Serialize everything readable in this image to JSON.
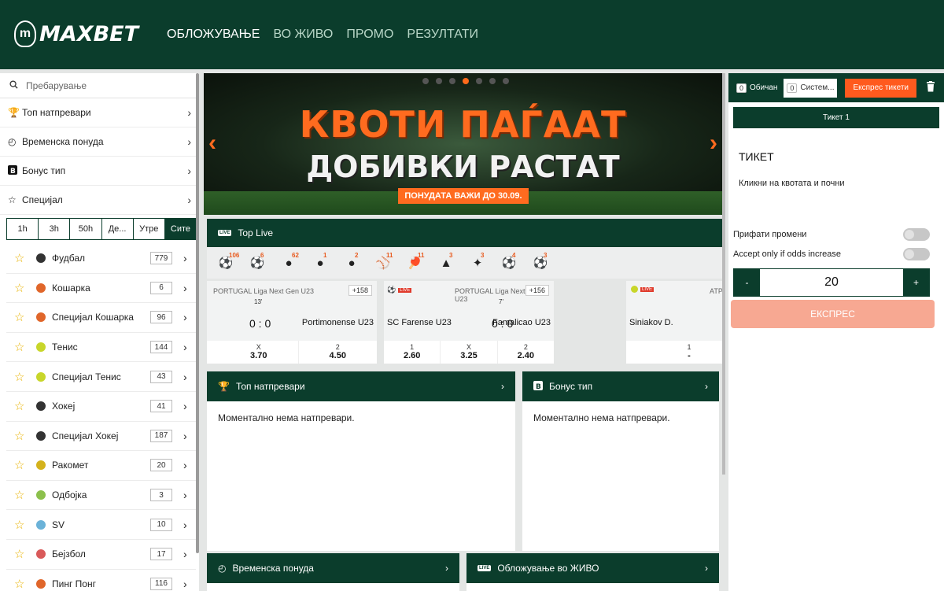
{
  "header": {
    "logo_badge": "m",
    "logo_text": "MAXBET",
    "nav": [
      {
        "label": "ОБЛОЖУВАЊЕ"
      },
      {
        "label": "ВО ЖИВО"
      },
      {
        "label": "ПРОМО"
      },
      {
        "label": "РЕЗУЛТАТИ"
      }
    ]
  },
  "sidebar": {
    "search_placeholder": "Пребарување",
    "menu": [
      {
        "label": "Топ натпревари",
        "icon": "trophy-icon"
      },
      {
        "label": "Временска понуда",
        "icon": "clock-icon"
      },
      {
        "label": "Бонус тип",
        "icon": "bonus-icon"
      },
      {
        "label": "Специјал",
        "icon": "star-icon"
      }
    ],
    "time_filters": [
      "1h",
      "3h",
      "50h",
      "Де...",
      "Утре",
      "Сите"
    ],
    "sports": [
      {
        "name": "Фудбал",
        "count": "779",
        "color": "#333333"
      },
      {
        "name": "Кошарка",
        "count": "6",
        "color": "#e0662a"
      },
      {
        "name": "Специјал Кошарка",
        "count": "96",
        "color": "#e0662a"
      },
      {
        "name": "Тенис",
        "count": "144",
        "color": "#c8d62a"
      },
      {
        "name": "Специјал Тенис",
        "count": "43",
        "color": "#c8d62a"
      },
      {
        "name": "Хокеј",
        "count": "41",
        "color": "#333333"
      },
      {
        "name": "Специјал Хокеј",
        "count": "187",
        "color": "#333333"
      },
      {
        "name": "Ракомет",
        "count": "20",
        "color": "#d4b21c"
      },
      {
        "name": "Одбојка",
        "count": "3",
        "color": "#8cc04c"
      },
      {
        "name": "SV",
        "count": "10",
        "color": "#6bb2d8"
      },
      {
        "name": "Бејзбол",
        "count": "17",
        "color": "#d95a5a"
      },
      {
        "name": "Пинг Понг",
        "count": "116",
        "color": "#e0662a"
      }
    ]
  },
  "banner": {
    "line1": "КВОТИ ПАЃААТ",
    "line2": "ДОБИВКИ РАСТАТ",
    "caption": "ПОНУДАТА ВАЖИ ДО 30.09."
  },
  "top_live": {
    "title": "Top Live",
    "live_label": "LIVE",
    "sport_icons": [
      {
        "glyph": "⚽",
        "count": "106"
      },
      {
        "glyph": "⚽",
        "count": "6"
      },
      {
        "glyph": "●",
        "count": "62"
      },
      {
        "glyph": "●",
        "count": "1"
      },
      {
        "glyph": "●",
        "count": "2"
      },
      {
        "glyph": "⚾",
        "count": "11"
      },
      {
        "glyph": "🏓",
        "count": "11"
      },
      {
        "glyph": "▲",
        "count": "3"
      },
      {
        "glyph": "✦",
        "count": "3"
      },
      {
        "glyph": "⚽",
        "count": "4"
      },
      {
        "glyph": "⚽",
        "count": "3"
      }
    ],
    "matches": [
      {
        "league": "PORTUGAL Liga Next Gen U23",
        "minute": "13'",
        "plus": "+158",
        "score": "0 : 0",
        "home": "",
        "away": "Portimonense U23",
        "odds": [
          {
            "label": "X",
            "value": "3.70"
          },
          {
            "label": "2",
            "value": "4.50"
          }
        ]
      },
      {
        "league": "PORTUGAL Liga Next Gen U23",
        "minute": "7'",
        "plus": "+156",
        "score": "0 : 0",
        "home": "SC Farense U23",
        "away": "Famalicao U23",
        "odds": [
          {
            "label": "1",
            "value": "2.60"
          },
          {
            "label": "X",
            "value": "3.25"
          },
          {
            "label": "2",
            "value": "2.40"
          }
        ]
      },
      {
        "league": "ATP",
        "minute": "",
        "plus": "",
        "score": "",
        "home": "Siniakov D.",
        "away": "",
        "odds": [
          {
            "label": "1",
            "value": "-"
          }
        ]
      }
    ]
  },
  "panels": {
    "top_matches": {
      "title": "Топ натпревари",
      "empty": "Моментално нема натпревари."
    },
    "bonus_tip": {
      "title": "Бонус тип",
      "empty": "Моментално нема натпревари."
    },
    "time_offer": {
      "title": "Временска понуда"
    },
    "live_betting": {
      "title": "Обложување во ЖИВО"
    }
  },
  "ticket": {
    "tab_normal_count": "0",
    "tab_normal_label": "Обичан",
    "tab_system_count": "0",
    "tab_system_label": "Систем...",
    "express_tickets_label": "Експрес тикети",
    "ticket_tab": "Тикет 1",
    "title": "ТИКЕТ",
    "hint": "Кликни на квотата и почни",
    "accept_changes": "Прифати промени",
    "accept_increase": "Accept only if odds increase",
    "minus": "-",
    "plus": "+",
    "stake": "20",
    "express_button": "ЕКСПРЕС"
  }
}
